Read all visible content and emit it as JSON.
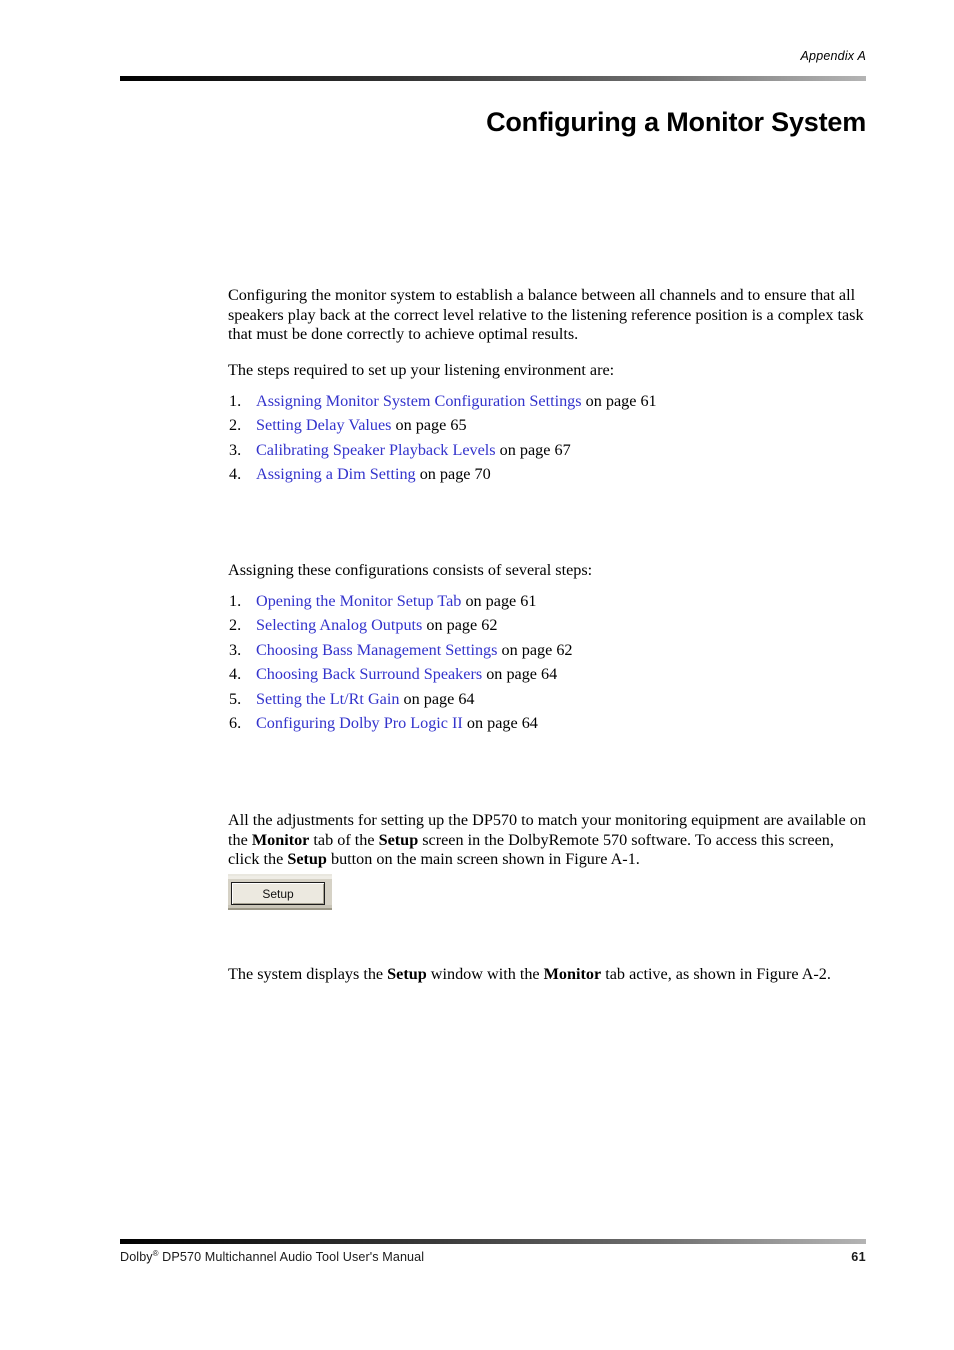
{
  "page": {
    "running_head": "Appendix A",
    "chapter_title": "Configuring a Monitor System",
    "footer_left_prefix": "Dolby",
    "footer_left_suffix": " DP570 Multichannel Audio Tool User's Manual",
    "footer_registered_mark": "®",
    "page_number": "61",
    "link_color": "#3333CC",
    "rule_color_start": "#000000",
    "rule_color_end": "#B4B4B4"
  },
  "intro": {
    "paragraph": "Configuring the monitor system to establish a balance between all channels and to ensure that all speakers play back at the correct level relative to the listening reference position is a complex task that must be done correctly to achieve optimal results.",
    "lead_in": "The steps required to set up your listening environment are:"
  },
  "steps_list": [
    {
      "num": "1.",
      "link": "Assigning Monitor System Configuration Settings",
      "tail": " on page 61"
    },
    {
      "num": "2.",
      "link": "Setting Delay Values",
      "tail": " on page 65"
    },
    {
      "num": "3.",
      "link": "Calibrating Speaker Playback Levels",
      "tail": " on page 67"
    },
    {
      "num": "4.",
      "link": "Assigning a Dim Setting",
      "tail": " on page 70"
    }
  ],
  "assigning_section": {
    "lead_in": "Assigning these configurations consists of several steps:",
    "items": [
      {
        "num": "1.",
        "link": "Opening the Monitor Setup Tab",
        "tail": " on page 61"
      },
      {
        "num": "2.",
        "link": "Selecting Analog Outputs",
        "tail": " on page 62"
      },
      {
        "num": "3.",
        "link": "Choosing Bass Management Settings",
        "tail": " on page 62"
      },
      {
        "num": "4.",
        "link": "Choosing Back Surround Speakers",
        "tail": " on page 64"
      },
      {
        "num": "5.",
        "link": "Setting the Lt/Rt Gain",
        "tail": " on page 64"
      },
      {
        "num": "6.",
        "link": "Configuring Dolby Pro Logic II",
        "tail": " on page 64"
      }
    ]
  },
  "setup_section": {
    "paragraph_1a": "All the adjustments for setting up the DP570 to match your monitoring equipment are available on the ",
    "bold_monitor": "Monitor",
    "paragraph_1b": " tab of the ",
    "bold_setup_1": "Setup",
    "paragraph_1c": " screen in the DolbyRemote 570 software. To access this screen, click the ",
    "bold_setup_2": "Setup",
    "paragraph_1d": " button on the main screen shown in Figure A-1.",
    "setup_button_label": "Setup",
    "paragraph_2a": "The system displays the ",
    "bold_setup_3": "Setup",
    "paragraph_2b": " window with the ",
    "bold_monitor_2": "Monitor",
    "paragraph_2c": " tab active, as shown in Figure A-2."
  }
}
